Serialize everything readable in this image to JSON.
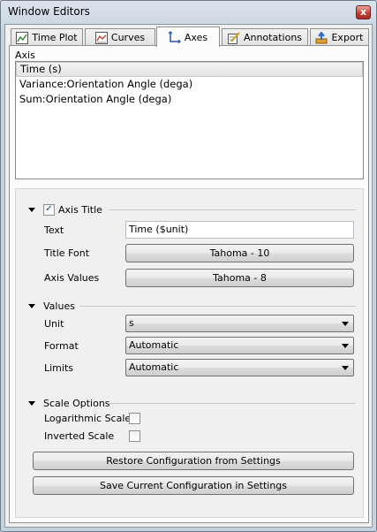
{
  "window": {
    "title": "Window Editors",
    "close_glyph": "x"
  },
  "tabs": [
    {
      "label": "Time Plot",
      "icon": "time-plot-icon"
    },
    {
      "label": "Curves",
      "icon": "curves-icon"
    },
    {
      "label": "Axes",
      "icon": "axes-icon",
      "active": true
    },
    {
      "label": "Annotations",
      "icon": "annotations-icon"
    },
    {
      "label": "Export",
      "icon": "export-icon"
    }
  ],
  "axis_list": {
    "label": "Axis",
    "items": [
      "Time (s)",
      "Variance:Orientation Angle (dega)",
      "Sum:Orientation Angle (dega)"
    ],
    "selected_index": 0
  },
  "axis_title": {
    "header": "Axis Title",
    "checked": true,
    "check_glyph": "✓",
    "text_label": "Text",
    "text_value": "Time ($unit)",
    "title_font_label": "Title Font",
    "title_font_value": "Tahoma - 10",
    "axis_values_label": "Axis Values",
    "axis_values_font": "Tahoma - 8"
  },
  "values": {
    "header": "Values",
    "unit_label": "Unit",
    "unit_value": "s",
    "format_label": "Format",
    "format_value": "Automatic",
    "limits_label": "Limits",
    "limits_value": "Automatic"
  },
  "scale_options": {
    "header": "Scale Options",
    "log_label": "Logarithmic Scale",
    "log_checked": false,
    "inverted_label": "Inverted Scale",
    "inverted_checked": false
  },
  "buttons": {
    "restore": "Restore Configuration from Settings",
    "save": "Save Current Configuration in Settings"
  }
}
